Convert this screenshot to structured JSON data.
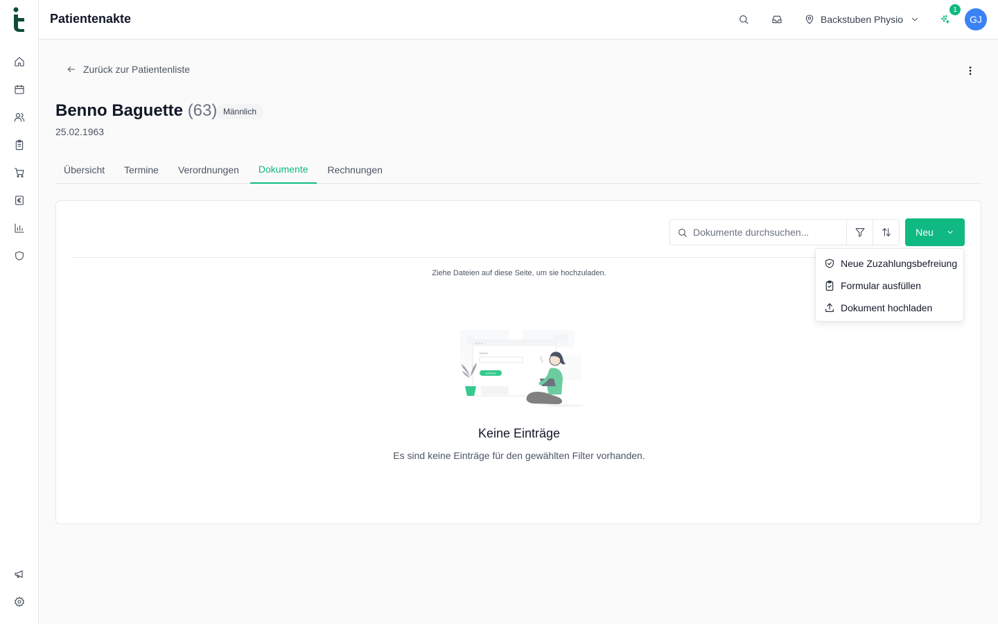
{
  "header": {
    "title": "Patientenakte",
    "location": "Backstuben Physio",
    "notification_count": "1",
    "avatar_initials": "GJ"
  },
  "patient": {
    "back_label": "Zurück zur Patientenliste",
    "name": "Benno Baguette",
    "age": "(63)",
    "gender": "Männlich",
    "birthdate": "25.02.1963"
  },
  "tabs": [
    {
      "label": "Übersicht",
      "active": false
    },
    {
      "label": "Termine",
      "active": false
    },
    {
      "label": "Verordnungen",
      "active": false
    },
    {
      "label": "Dokumente",
      "active": true
    },
    {
      "label": "Rechnungen",
      "active": false
    }
  ],
  "documents": {
    "search_placeholder": "Dokumente durchsuchen...",
    "new_button": "Neu",
    "drop_hint": "Ziehe Dateien auf diese Seite, um sie hochzuladen.",
    "empty_title": "Keine Einträge",
    "empty_subtitle": "Es sind keine Einträge für den gewählten Filter vorhanden.",
    "illustration_field_label": "Name",
    "illustration_button_label": "Continue"
  },
  "new_menu": {
    "items": [
      {
        "label": "Neue Zuzahlungsbefreiung",
        "icon": "shield-check-icon"
      },
      {
        "label": "Formular ausfüllen",
        "icon": "clipboard-check-icon"
      },
      {
        "label": "Dokument hochladen",
        "icon": "upload-icon"
      }
    ]
  },
  "colors": {
    "accent": "#10b981",
    "avatar": "#3b82f6",
    "logo": "#0f4c3a"
  }
}
